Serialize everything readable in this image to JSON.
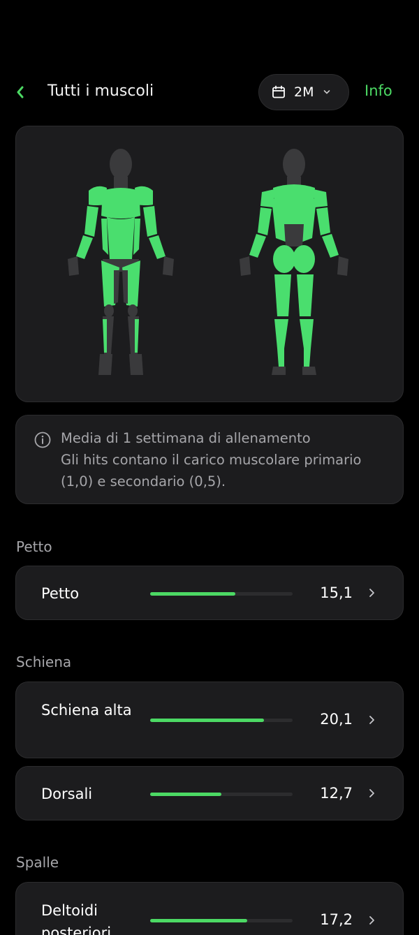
{
  "header": {
    "title": "Tutti i muscoli",
    "period_label": "2M",
    "info_label": "Info"
  },
  "colors": {
    "accent": "#4cd964",
    "card": "#1c1c1e",
    "muscle_active": "#4ade6e",
    "muscle_inactive": "#3a3a3c"
  },
  "note": {
    "line1": "Media di 1 settimana di allenamento",
    "line2": "Gli hits contano il carico muscolare primario (1,0) e secondario (0,5)."
  },
  "sections": [
    {
      "title": "Petto",
      "rows": [
        {
          "label": "Petto",
          "value": "15,1",
          "fill": 0.6
        }
      ]
    },
    {
      "title": "Schiena",
      "rows": [
        {
          "label": "Schiena alta",
          "value": "20,1",
          "fill": 0.8
        },
        {
          "label": "Dorsali",
          "value": "12,7",
          "fill": 0.5
        }
      ]
    },
    {
      "title": "Spalle",
      "rows": [
        {
          "label": "Deltoidi posteriori",
          "value": "17,2",
          "fill": 0.68
        }
      ]
    }
  ]
}
